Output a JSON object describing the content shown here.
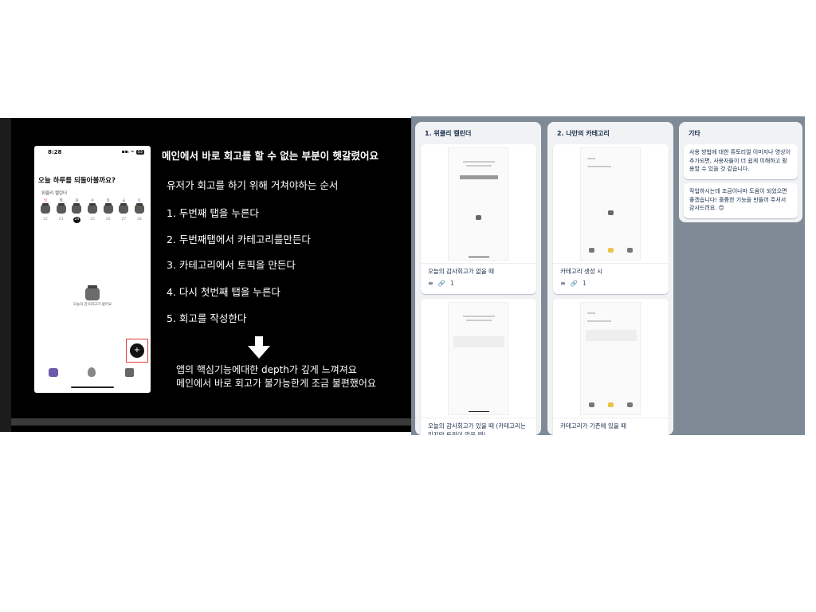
{
  "slide": {
    "title": "메인에서 바로 회고를 할 수 없는 부분이 헷갈렸어요",
    "steps_intro": "유저가 회고를 하기 위해 거쳐야하는 순서",
    "steps": [
      "1. 두번째 탭을 누른다",
      "2. 두번째탭에서 카테고리를만든다",
      "3. 카테고리에서 토픽을 만든다",
      "4. 다시 첫번째 탭을 누른다",
      "5. 회고를 작성한다"
    ],
    "conclusion": [
      "앱의 핵심기능에대한 depth가 깊게 느껴져요",
      "메인에서 바로 회고가 불가능한게 조금 불편했어요"
    ],
    "phone": {
      "time": "8:28",
      "status": "▪▪ᵢ ≈",
      "battery": "53",
      "question": "오늘 하루를 되돌아볼까요?",
      "section": "위클리 캘린더",
      "weekdays": [
        "일",
        "월",
        "화",
        "수",
        "목",
        "금",
        "토"
      ],
      "dates": [
        "22",
        "23",
        "24",
        "25",
        "26",
        "27",
        "28"
      ],
      "today_index": 2,
      "empty_message": "오늘의 감사회고가 없어요",
      "fab_label": "+"
    }
  },
  "board": {
    "columns": [
      {
        "title": "1. 위클리 캘린더",
        "cards": [
          {
            "title": "오늘의 감사회고가 없을 때",
            "attachments": "1"
          },
          {
            "title": "오늘의 감사회고가 있을 때 (카테고리는 있지만 토픽이 없을 때)"
          }
        ]
      },
      {
        "title": "2. 나만의 카테고리",
        "cards": [
          {
            "title": "카테고리 생성 시",
            "attachments": "1"
          },
          {
            "title": "카테고리가 기존에 있을 때"
          }
        ]
      },
      {
        "title": "기타",
        "notes": [
          "사용 방법에 대한 튜토리얼 이미지나 영상이 추가되면, 사용자들이 더 쉽게 이해하고 활용할 수 있을 것 같습니다.",
          "작업하시는데 조금이나마 도움이 되었으면 좋겠습니다! 훌륭한 기능을 만들어 주셔서 감사드려요. 😊"
        ]
      }
    ]
  },
  "colors": {
    "slide_bg": "#000000",
    "board_bg": "#7f8a96",
    "column_bg": "#f1f2f4",
    "card_text": "#172b4d",
    "highlight": "#e23b3b"
  }
}
